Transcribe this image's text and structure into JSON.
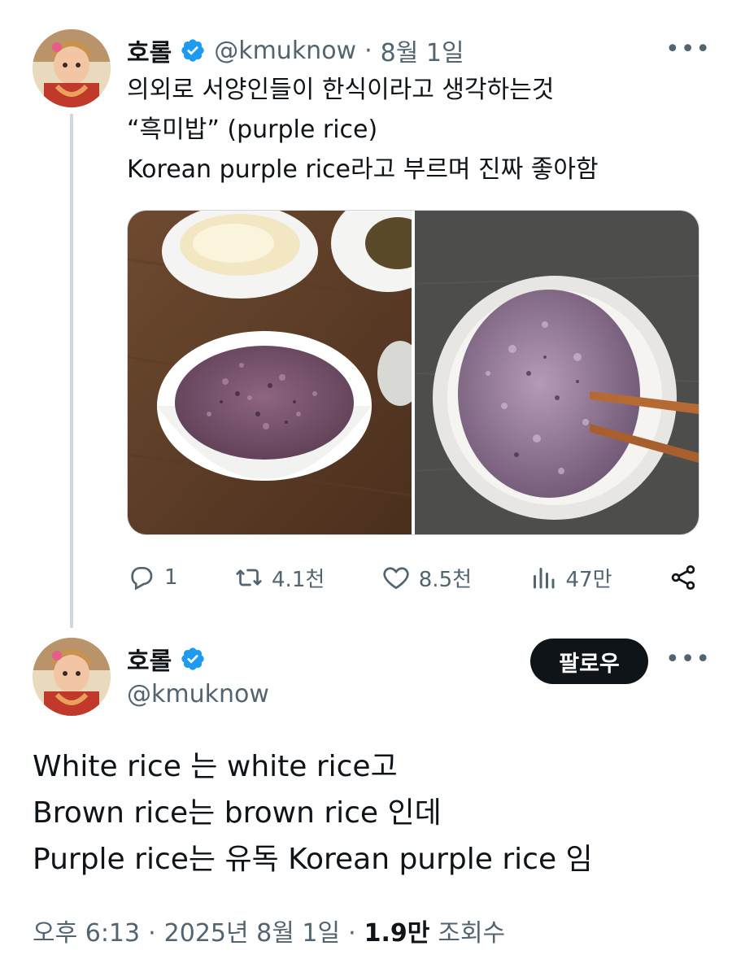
{
  "reply_tweet": {
    "display_name": "호롤",
    "handle": "@kmuknow",
    "separator": "·",
    "date": "8월 1일",
    "more": "•••",
    "text_lines": [
      "의외로 서양인들이 한식이라고 생각하는것",
      "“흑미밥” (purple rice)",
      "Korean purple rice라고 부르며 진짜 좋아함"
    ],
    "actions": {
      "replies": "1",
      "retweets": "4.1천",
      "likes": "8.5천",
      "views": "47만"
    },
    "icons": [
      "reply-icon",
      "retweet-icon",
      "like-icon",
      "views-icon",
      "share-icon"
    ]
  },
  "main_tweet": {
    "display_name": "호롤",
    "handle": "@kmuknow",
    "follow_label": "팔로우",
    "more": "•••",
    "text_lines": [
      "White rice 는 white rice고",
      "Brown rice는 brown rice 인데",
      "Purple rice는 유독 Korean purple rice 임"
    ],
    "time": "오후 6:13",
    "sep1": "·",
    "date": "2025년 8월 1일",
    "sep2": "·",
    "views_count": "1.9만",
    "views_label": "조회수"
  },
  "colors": {
    "text": "#0f1419",
    "secondary": "#536471",
    "verified": "#1d9bf0",
    "follow_bg": "#0f1419",
    "rice": "#7a5a78"
  }
}
